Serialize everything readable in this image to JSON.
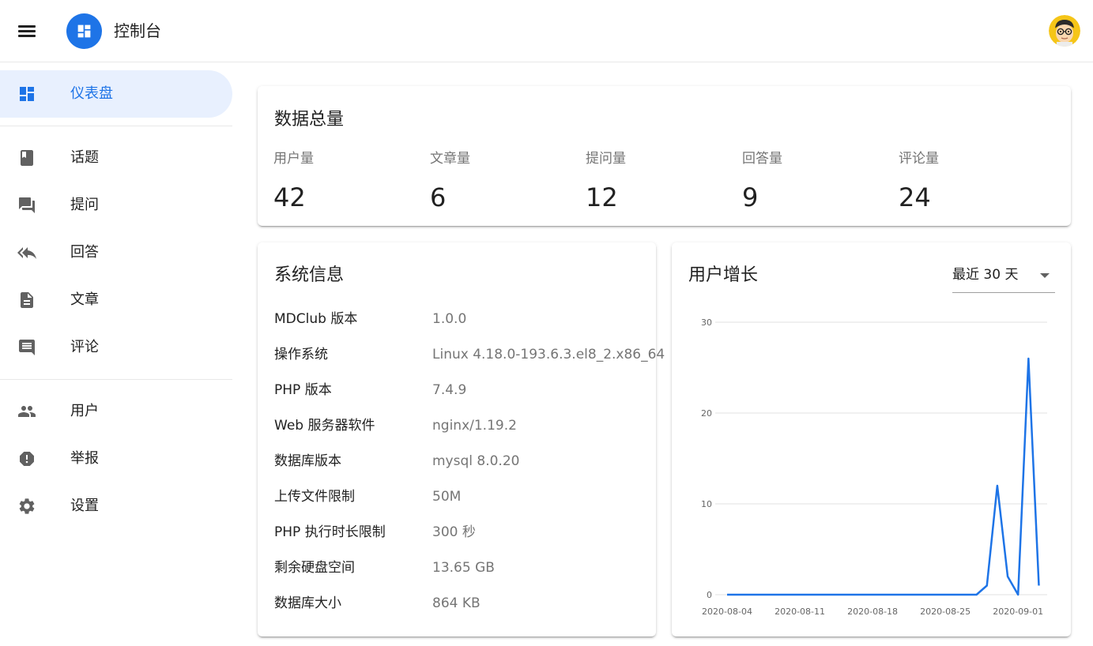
{
  "appbar": {
    "title": "控制台",
    "menu_icon": "menu-icon",
    "logo_icon": "dashboard-icon",
    "avatar": "user-avatar"
  },
  "sidebar": {
    "items": [
      {
        "label": "仪表盘",
        "icon": "dashboard-icon",
        "active": true
      },
      {
        "label": "话题",
        "icon": "book-icon"
      },
      {
        "label": "提问",
        "icon": "forum-icon"
      },
      {
        "label": "回答",
        "icon": "reply-all-icon"
      },
      {
        "label": "文章",
        "icon": "description-icon"
      },
      {
        "label": "评论",
        "icon": "comment-icon"
      },
      {
        "label": "用户",
        "icon": "people-icon"
      },
      {
        "label": "举报",
        "icon": "report-icon"
      },
      {
        "label": "设置",
        "icon": "settings-icon"
      }
    ]
  },
  "totals": {
    "title": "数据总量",
    "stats": [
      {
        "label": "用户量",
        "value": "42"
      },
      {
        "label": "文章量",
        "value": "6"
      },
      {
        "label": "提问量",
        "value": "12"
      },
      {
        "label": "回答量",
        "value": "9"
      },
      {
        "label": "评论量",
        "value": "24"
      }
    ]
  },
  "system": {
    "title": "系统信息",
    "rows": [
      {
        "key": "MDClub 版本",
        "value": "1.0.0"
      },
      {
        "key": "操作系统",
        "value": "Linux 4.18.0-193.6.3.el8_2.x86_64"
      },
      {
        "key": "PHP 版本",
        "value": "7.4.9"
      },
      {
        "key": "Web 服务器软件",
        "value": "nginx/1.19.2"
      },
      {
        "key": "数据库版本",
        "value": "mysql 8.0.20"
      },
      {
        "key": "上传文件限制",
        "value": "50M"
      },
      {
        "key": "PHP 执行时长限制",
        "value": "300 秒"
      },
      {
        "key": "剩余硬盘空间",
        "value": "13.65 GB"
      },
      {
        "key": "数据库大小",
        "value": "864 KB"
      }
    ]
  },
  "growth": {
    "title": "用户增长",
    "range_select": "最近 30 天"
  },
  "colors": {
    "accent": "#1e74e7",
    "active_bg": "#e8f0fe",
    "line": "#1e74e7"
  },
  "chart_data": {
    "type": "line",
    "title": "",
    "xlabel": "",
    "ylabel": "",
    "ylim": [
      0,
      30
    ],
    "yticks": [
      0,
      10,
      20,
      30
    ],
    "grid": true,
    "xtick_labels": [
      "2020-08-04",
      "2020-08-11",
      "2020-08-18",
      "2020-08-25",
      "2020-09-01"
    ],
    "x": [
      "2020-08-04",
      "2020-08-05",
      "2020-08-06",
      "2020-08-07",
      "2020-08-08",
      "2020-08-09",
      "2020-08-10",
      "2020-08-11",
      "2020-08-12",
      "2020-08-13",
      "2020-08-14",
      "2020-08-15",
      "2020-08-16",
      "2020-08-17",
      "2020-08-18",
      "2020-08-19",
      "2020-08-20",
      "2020-08-21",
      "2020-08-22",
      "2020-08-23",
      "2020-08-24",
      "2020-08-25",
      "2020-08-26",
      "2020-08-27",
      "2020-08-28",
      "2020-08-29",
      "2020-08-30",
      "2020-08-31",
      "2020-09-01",
      "2020-09-02",
      "2020-09-03"
    ],
    "series": [
      {
        "values": [
          0,
          0,
          0,
          0,
          0,
          0,
          0,
          0,
          0,
          0,
          0,
          0,
          0,
          0,
          0,
          0,
          0,
          0,
          0,
          0,
          0,
          0,
          0,
          0,
          0,
          1,
          12,
          2,
          0,
          26,
          1
        ]
      }
    ]
  }
}
